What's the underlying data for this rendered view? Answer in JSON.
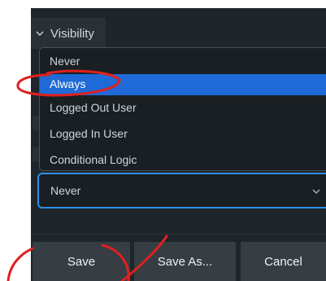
{
  "visibility": {
    "label": "Visibility"
  },
  "dropdown": {
    "options": [
      "Never",
      "Always",
      "Logged Out User",
      "Logged In User",
      "Conditional Logic"
    ],
    "highlighted": "Always"
  },
  "select": {
    "value": "Never"
  },
  "buttons": {
    "save": "Save",
    "save_as": "Save As...",
    "cancel": "Cancel"
  },
  "colors": {
    "panel_bg": "#1f262b",
    "highlight": "#1f6ad6",
    "focus_border": "#2c8fe8",
    "button_bg": "#363e44",
    "annotation": "#e0201e"
  }
}
